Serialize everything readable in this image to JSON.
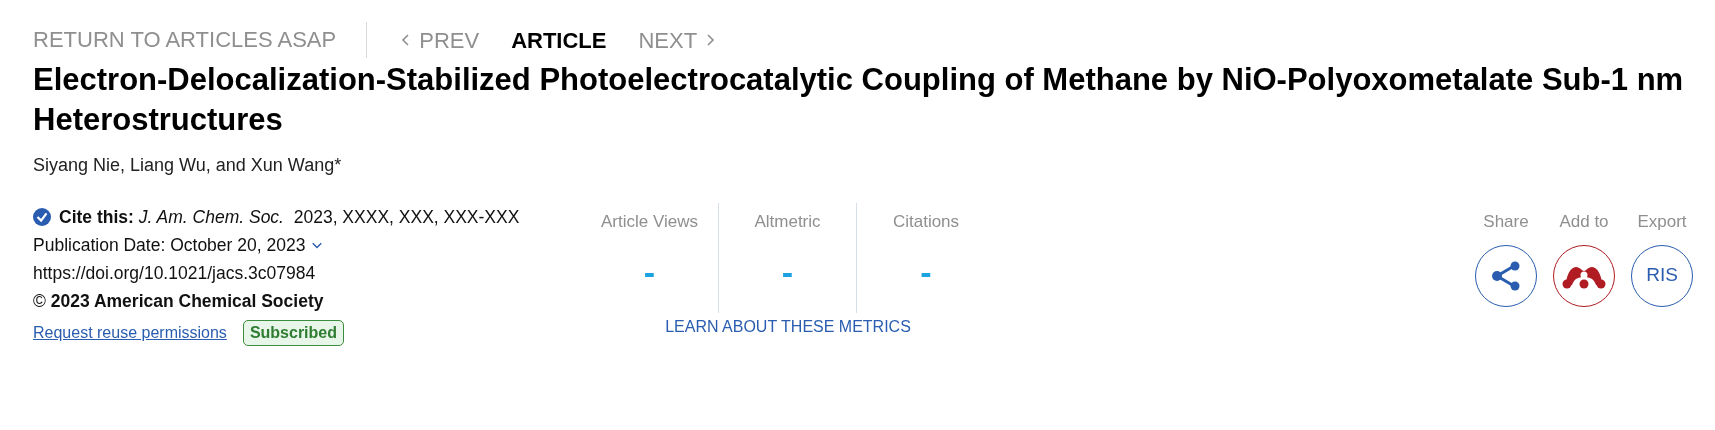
{
  "nav": {
    "return_link": "RETURN TO ARTICLES ASAP",
    "items": [
      {
        "label": "PREV",
        "kind": "prev",
        "selected": false
      },
      {
        "label": "ARTICLE",
        "kind": "current",
        "selected": true
      },
      {
        "label": "NEXT",
        "kind": "next",
        "selected": false
      }
    ]
  },
  "title": "Electron-Delocalization-Stabilized Photoelectrocatalytic Coupling of Methane by NiO-Polyoxometalate Sub-1 nm Heterostructures",
  "authors": "Siyang Nie, Liang Wu, and Xun Wang*",
  "citation": {
    "label": "Cite this:",
    "journal": "J. Am. Chem. Soc.",
    "details": "2023, XXXX, XXX, XXX-XXX"
  },
  "publication_date": "Publication Date: October 20, 2023",
  "doi": "https://doi.org/10.1021/jacs.3c07984",
  "copyright": "© **2023 American Chemical Society**",
  "permissions_link": "Request reuse permissions",
  "access_badge": "Subscribed",
  "metrics": [
    {
      "label": "Article Views",
      "value": "-"
    },
    {
      "label": "Altmetric",
      "value": "-"
    },
    {
      "label": "Citations",
      "value": "-"
    }
  ],
  "metrics_link": "LEARN ABOUT THESE METRICS",
  "actions": [
    {
      "label": "Share",
      "kind": "share"
    },
    {
      "label": "Add to",
      "kind": "mendeley"
    },
    {
      "label": "Export",
      "kind": "ris",
      "button_text": "RIS"
    }
  ]
}
